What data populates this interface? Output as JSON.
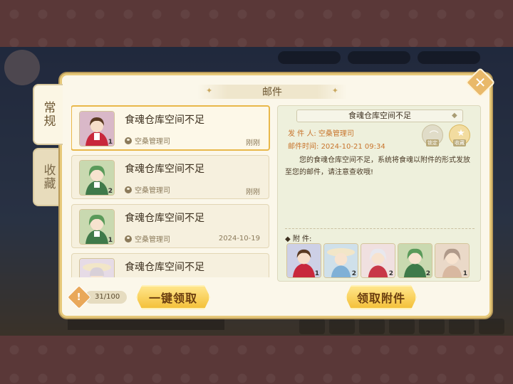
{
  "panel": {
    "title": "邮件"
  },
  "tabs": [
    {
      "label": "常规"
    },
    {
      "label": "收藏"
    }
  ],
  "mails": [
    {
      "subject": "食魂仓库空间不足",
      "sender": "空桑管理司",
      "date": "刚刚",
      "qty": "1"
    },
    {
      "subject": "食魂仓库空间不足",
      "sender": "空桑管理司",
      "date": "刚刚",
      "qty": "2"
    },
    {
      "subject": "食魂仓库空间不足",
      "sender": "空桑管理司",
      "date": "2024-10-19",
      "qty": "1"
    },
    {
      "subject": "食魂仓库空间不足",
      "sender": "",
      "date": "",
      "qty": ""
    }
  ],
  "detail": {
    "title": "食魂仓库空间不足",
    "sender_label": "发 件 人:",
    "sender": "空桑管理司",
    "time_label": "邮件时间:",
    "time": "2024-10-21  09:34",
    "lock_label": "锁定",
    "fav_label": "收藏",
    "body": "您的食魂仓库空间不足，系统将食魂以附件的形式发放至您的邮件，请注意查收哦!",
    "attach_label": "◆ 附        件:",
    "attachments": [
      {
        "qty": "1"
      },
      {
        "qty": "2"
      },
      {
        "qty": "2"
      },
      {
        "qty": "2"
      },
      {
        "qty": "1"
      }
    ]
  },
  "footer": {
    "count": "31/100",
    "claim_all": "一键领取",
    "claim_attach": "领取附件"
  },
  "colors": {
    "accent_gold": "#f4c13a",
    "meta_orange": "#c8742c",
    "panel_bg": "#fbf7ea"
  }
}
